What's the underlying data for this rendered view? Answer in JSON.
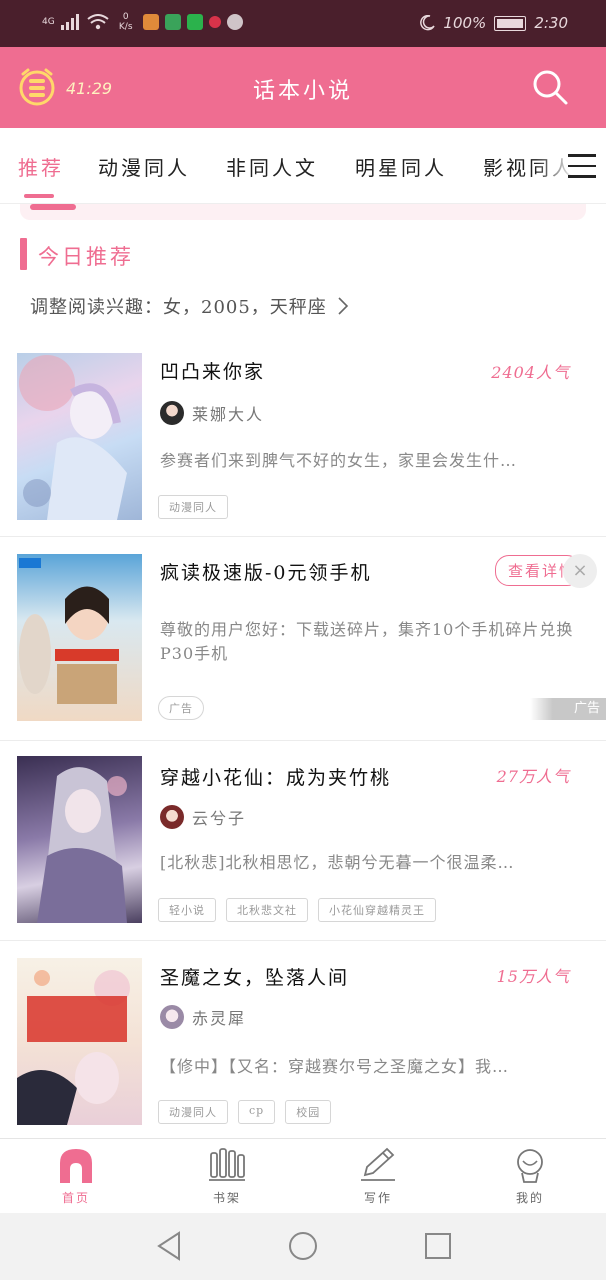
{
  "status_bar": {
    "network": "4G",
    "speed": "0 K/s",
    "battery": "100%",
    "time": "2:30"
  },
  "header": {
    "timer": "41:29",
    "title": "话本小说"
  },
  "tabs": [
    {
      "label": "推荐",
      "active": true
    },
    {
      "label": "动漫同人"
    },
    {
      "label": "非同人文"
    },
    {
      "label": "明星同人"
    },
    {
      "label": "影视同人"
    }
  ],
  "section": {
    "title": "今日推荐",
    "interest": "调整阅读兴趣：女，2005，天秤座"
  },
  "books": [
    {
      "title": "凹凸来你家",
      "popularity": "2404人气",
      "author": "莱娜大人",
      "description": "参赛者们来到脾气不好的女生，家里会发生什…",
      "tags": [
        "动漫同人"
      ]
    },
    {
      "title": "穿越小花仙：成为夹竹桃",
      "popularity": "27万人气",
      "author": "云兮子",
      "description": "[北秋悲]北秋相思忆，悲朝兮无暮一个很温柔…",
      "tags": [
        "轻小说",
        "北秋悲文社",
        "小花仙穿越精灵王"
      ]
    },
    {
      "title": "圣魔之女，坠落人间",
      "popularity": "15万人气",
      "author": "赤灵犀",
      "description": "【修中】【又名：穿越赛尔号之圣魔之女】我…",
      "tags": [
        "动漫同人",
        "cp",
        "校园"
      ]
    }
  ],
  "ad": {
    "title": "疯读极速版-0元领手机",
    "description": "尊敬的用户您好：下载送碎片，集齐10个手机碎片兑换P30手机",
    "detail_button": "查看详情",
    "tag": "广告",
    "ad_label": "广告",
    "close": "×"
  },
  "bottom_nav": [
    {
      "label": "首页",
      "active": true
    },
    {
      "label": "书架"
    },
    {
      "label": "写作"
    },
    {
      "label": "我的"
    }
  ],
  "colors": {
    "accent": "#ef6d91",
    "status_bar": "#4a1f2c"
  }
}
